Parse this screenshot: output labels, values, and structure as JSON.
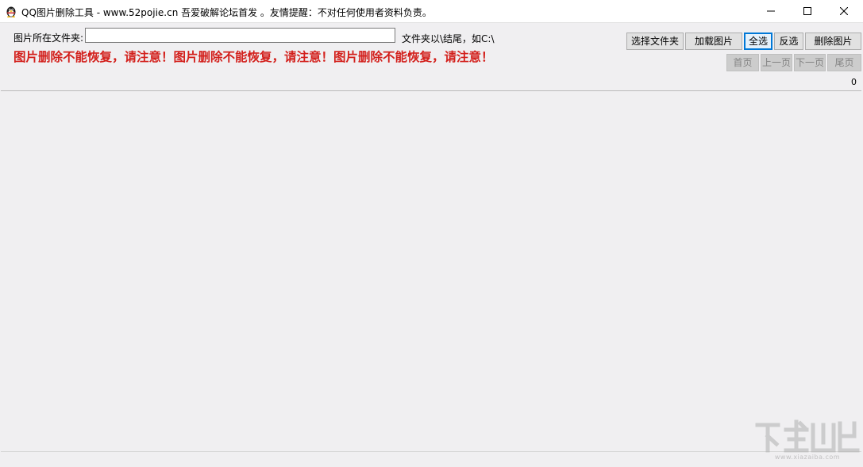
{
  "window": {
    "title": "QQ图片删除工具 - www.52pojie.cn 吾爱破解论坛首发 。友情提醒：不对任何使用者资料负责。",
    "icon": "qq-penguin-icon",
    "controls": {
      "minimize_icon": "minimize-icon",
      "maximize_icon": "maximize-icon",
      "close_icon": "close-icon"
    }
  },
  "folder": {
    "label": "图片所在文件夹:",
    "value": "",
    "hint": "文件夹以\\结尾，如C:\\"
  },
  "warning": {
    "text": "图片删除不能恢复，请注意！图片删除不能恢复，请注意！图片删除不能恢复，请注意！",
    "color": "#d3201c"
  },
  "toolbar": {
    "select_folder": "选择文件夹",
    "load_images": "加载图片",
    "select_all": "全选",
    "invert_selection": "反选",
    "delete_images": "删除图片"
  },
  "pagination": {
    "first": "首页",
    "prev": "上一页",
    "next": "下一页",
    "last": "尾页",
    "count": "0"
  },
  "watermark": {
    "text": "www.xiazaiba.com"
  }
}
